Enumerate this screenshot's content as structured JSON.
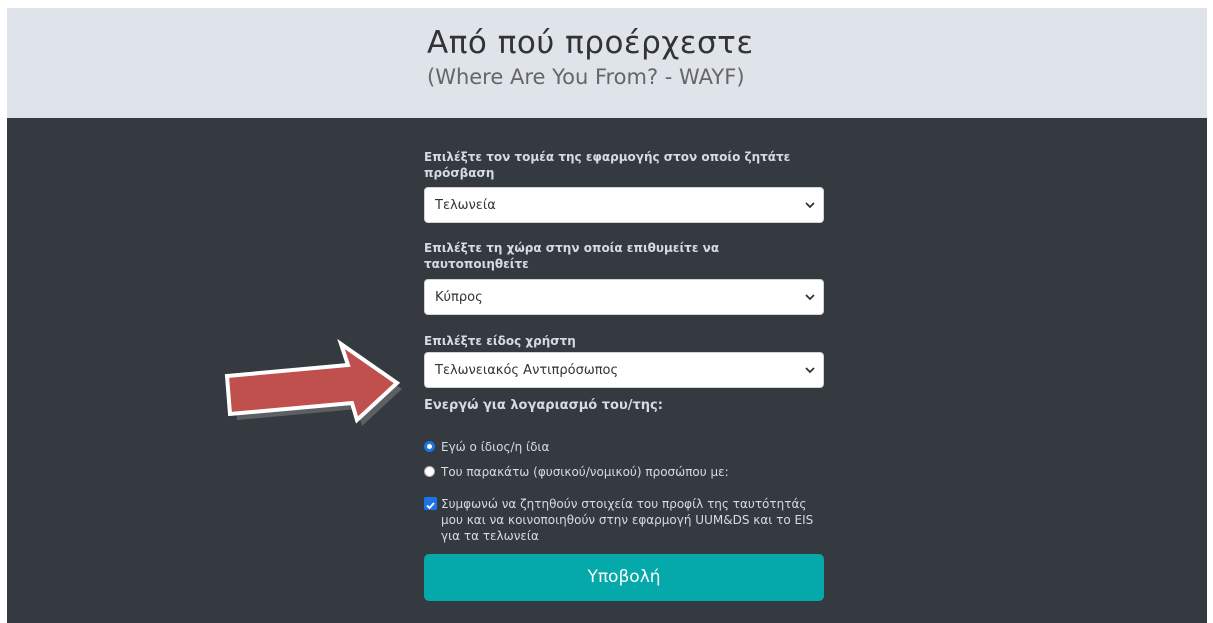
{
  "header": {
    "title": "Από πού προέρχεστε",
    "subtitle": "(Where Are You From? - WAYF)"
  },
  "form": {
    "sector_label": "Επιλέξτε τον τομέα της εφαρμογής στον οποίο ζητάτε πρόσβαση",
    "sector_value": "Τελωνεία",
    "country_label": "Επιλέξτε τη χώρα στην οποία επιθυμείτε να ταυτοποιηθείτε",
    "country_value": "Κύπρος",
    "user_type_label": "Επιλέξτε είδος χρήστη",
    "user_type_value": "Τελωνειακός Αντιπρόσωπος",
    "acting_for_label": "Ενεργώ για λογαριασμό του/της:",
    "radio_self": "Εγώ ο ίδιος/η ίδια",
    "radio_other": "Του παρακάτω (φυσικού/νομικού) προσώπου με:",
    "consent": "Συμφωνώ να ζητηθούν στοιχεία του προφίλ της ταυτότητάς μου και να κοινοποιηθούν στην εφαρμογή UUM&DS και το EIS για τα τελωνεία",
    "submit": "Υποβολή"
  },
  "colors": {
    "header_bg": "#dfe3ea",
    "panel_bg": "#343a40",
    "accent": "#06a9aa",
    "arrow": "#c0504d",
    "checkbox": "#1a73e8"
  },
  "icons": {
    "select_chevron": "chevron-down-icon",
    "annotation": "arrow-right-icon",
    "check": "checkmark-icon"
  }
}
